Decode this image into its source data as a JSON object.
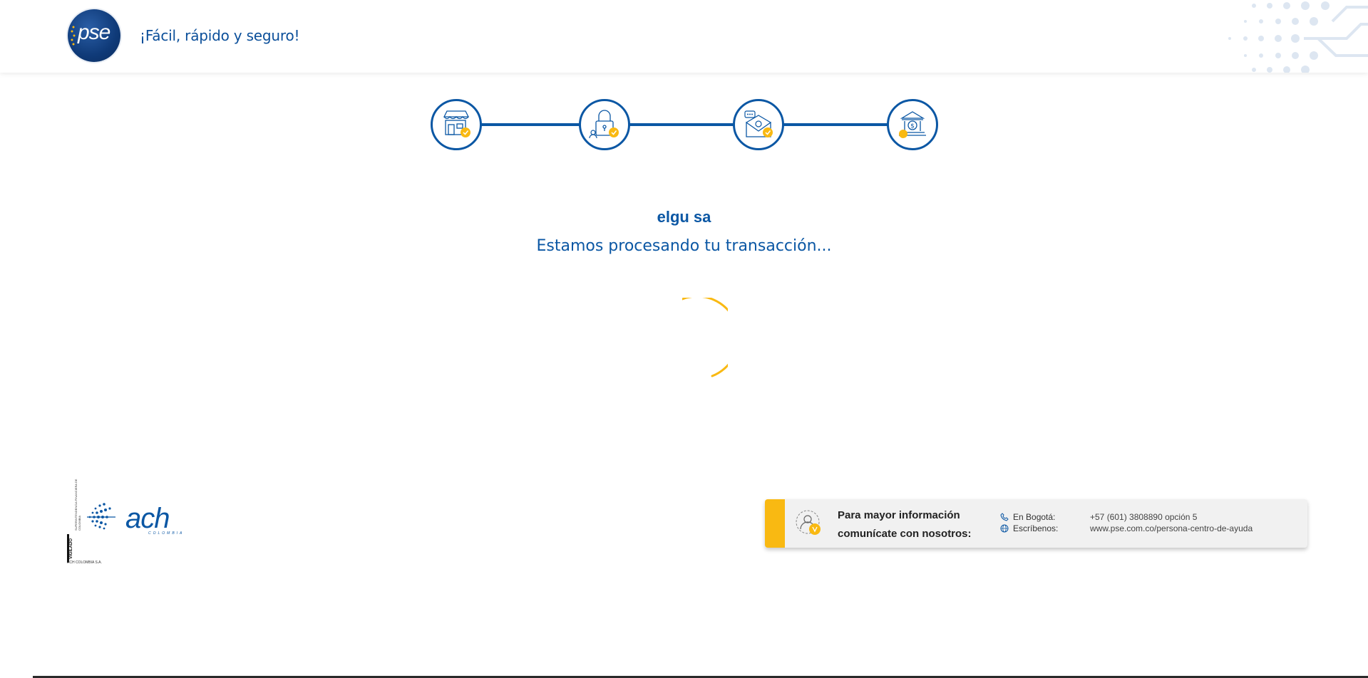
{
  "header": {
    "logo_text": "pse",
    "tagline": "¡Fácil, rápido y seguro!"
  },
  "stepper": {
    "steps": [
      "store-icon",
      "lock-icon",
      "email-icon",
      "bank-icon"
    ]
  },
  "main": {
    "merchant": "elgu sa",
    "status": "Estamos procesando tu transacción..."
  },
  "footer": {
    "ach_logo_text": "ach",
    "ach_logo_sub": "COLOMBIA",
    "vigilado": "VIGILADO",
    "superintendencia": "SUPERINTENDENCIA FINANCIERA DE COLOMBIA",
    "ach_company": "ACH COLOMBIA S.A."
  },
  "info_card": {
    "heading_line1": "Para mayor información",
    "heading_line2": "comunícate con nosotros:",
    "rows": [
      {
        "label": "En Bogotá:",
        "value": "+57 (601) 3808890 opción 5",
        "icon": "phone-icon"
      },
      {
        "label": "Escríbenos:",
        "value": "www.pse.com.co/persona-centro-de-ayuda",
        "icon": "globe-icon"
      }
    ]
  },
  "colors": {
    "primary": "#0b57a4",
    "accent": "#f9b912"
  }
}
